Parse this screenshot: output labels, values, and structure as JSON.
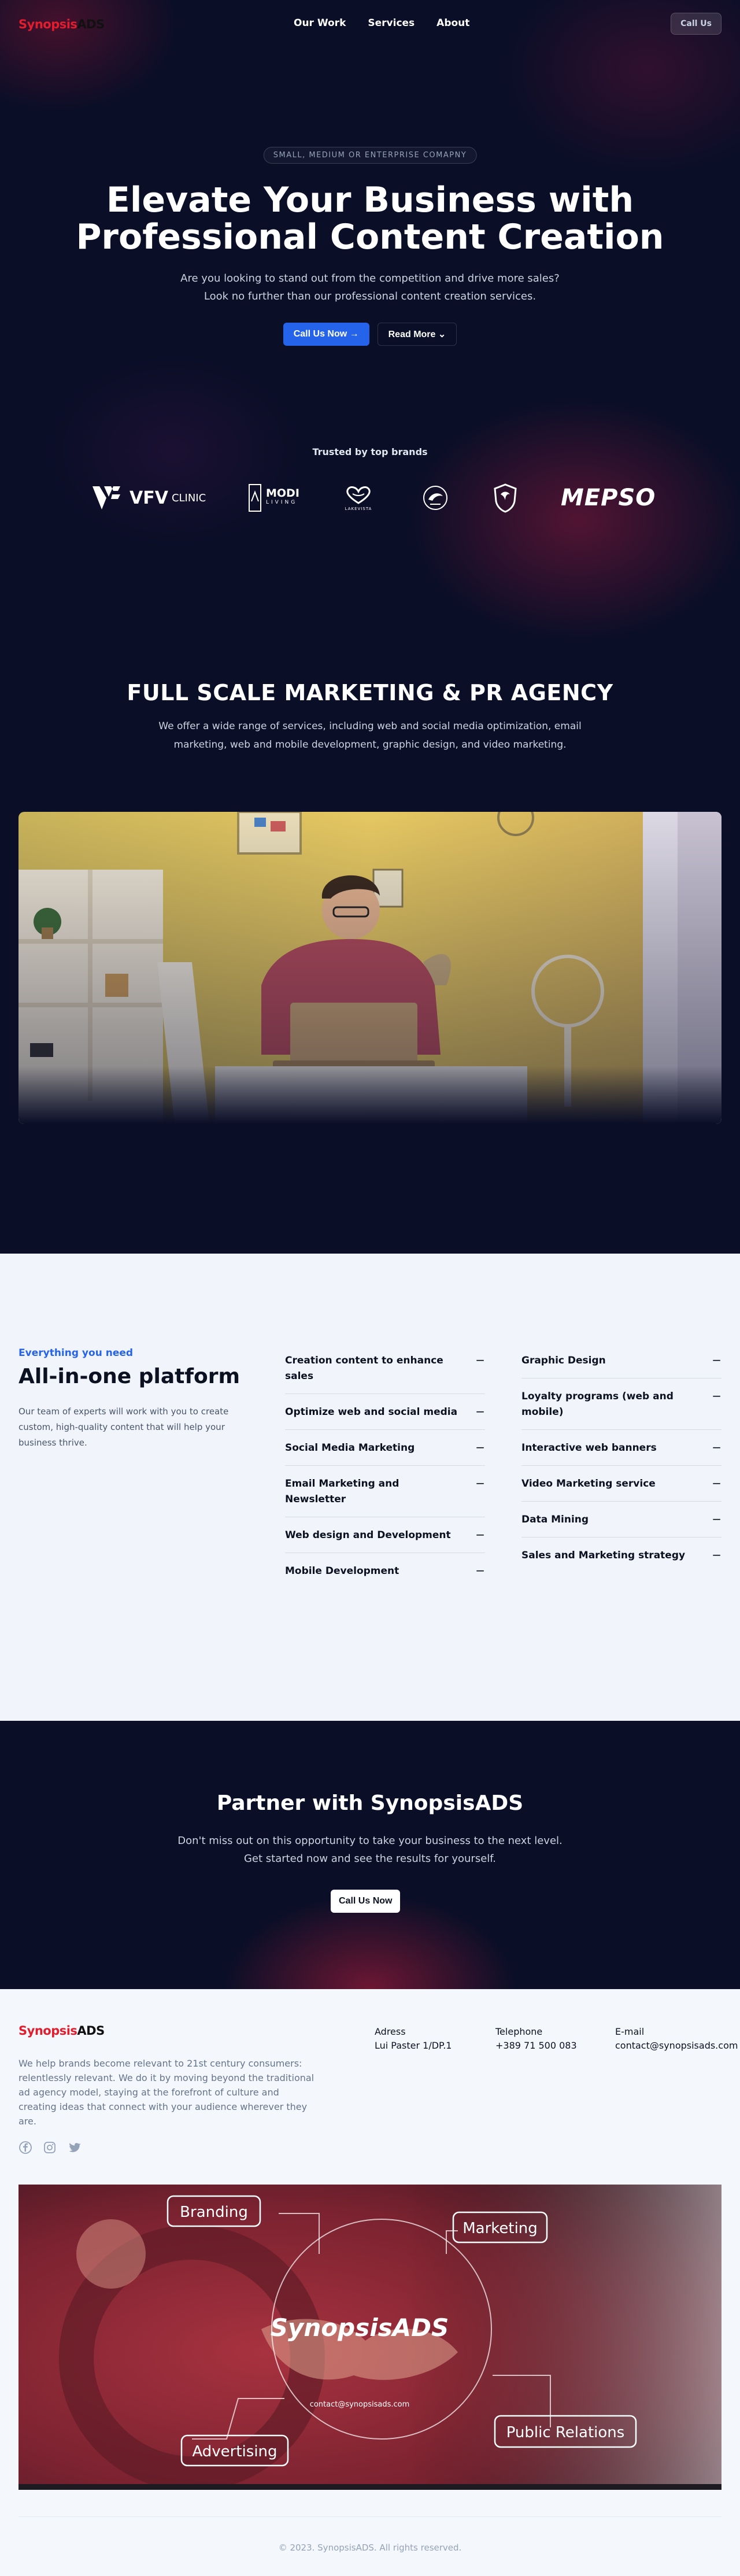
{
  "brand": {
    "logo_part1": "Synopsis",
    "logo_part2": "ADS"
  },
  "nav": {
    "items": [
      {
        "label": "Our Work"
      },
      {
        "label": "Services"
      },
      {
        "label": "About"
      }
    ],
    "cta_label": "Call Us"
  },
  "hero": {
    "badge": "SMALL, MEDIUM OR ENTERPRISE COMAPNY",
    "title_line1": "Elevate Your Business with",
    "title_line2": "Professional Content Creation",
    "subtitle_line1": "Are you looking to stand out from the competition and drive more sales?",
    "subtitle_line2": "Look no further than our professional content creation services.",
    "primary_button": "Call Us Now →",
    "secondary_button": "Read More ⌄"
  },
  "trusted": {
    "heading": "Trusted by top brands",
    "logos": [
      {
        "text": "VFV",
        "suffix": "CLINIC"
      },
      {
        "text": "MODI",
        "suffix": "LIVING"
      },
      {
        "text": "LAKEVISTA"
      },
      {
        "text": ""
      },
      {
        "text": ""
      },
      {
        "text": "MEPSO"
      }
    ]
  },
  "agency": {
    "title": "FULL SCALE MARKETING & PR AGENCY",
    "text": "We offer a wide range of services, including web and social media optimization, email marketing, web and mobile development, graphic design, and video marketing."
  },
  "platform": {
    "eyebrow": "Everything you need",
    "title": "All-in-one platform",
    "text": "Our team of experts will work with you to create custom, high-quality content that will help your business thrive.",
    "toggle_symbol": "−",
    "column1": [
      {
        "label": "Creation content to enhance sales"
      },
      {
        "label": "Optimize web and social media"
      },
      {
        "label": "Social Media Marketing"
      },
      {
        "label": "Email Marketing and Newsletter"
      },
      {
        "label": "Web design and Development"
      },
      {
        "label": "Mobile Development"
      }
    ],
    "column2": [
      {
        "label": "Graphic Design"
      },
      {
        "label": "Loyalty programs (web and mobile)"
      },
      {
        "label": "Interactive web banners"
      },
      {
        "label": "Video Marketing service"
      },
      {
        "label": "Data Mining"
      },
      {
        "label": "Sales and Marketing strategy"
      }
    ]
  },
  "cta": {
    "title": "Partner with SynopsisADS",
    "text_line1": "Don't miss out on this opportunity to take your business to the next level.",
    "text_line2": "Get started now and see the results for yourself.",
    "button": "Call Us Now"
  },
  "footer": {
    "text": "We help brands become relevant to 21st century consumers: relentlessly relevant. We do it by moving beyond the traditional ad agency model, staying at the forefront of culture and creating ideas that connect with your audience wherever they are.",
    "socials": [
      {
        "icon": "facebook-icon"
      },
      {
        "icon": "instagram-icon"
      },
      {
        "icon": "twitter-icon"
      }
    ],
    "address_label": "Adress",
    "address_value": "Lui Paster 1/DP.1",
    "phone_label": "Telephone",
    "phone_value": "+389 71 500 083",
    "email_label": "E-mail",
    "email_value": "contact@synopsisads.com",
    "banner": {
      "center": "SynopsisADS",
      "email": "contact@synopsisads.com",
      "tags": [
        "Branding",
        "Marketing",
        "Advertising",
        "Public Relations"
      ]
    },
    "copyright": "© 2023. SynopsisADS. All rights reserved."
  },
  "colors": {
    "accent": "#2563eb",
    "brand_red": "#e11d2e",
    "dark_bg": "#0a0e27"
  }
}
